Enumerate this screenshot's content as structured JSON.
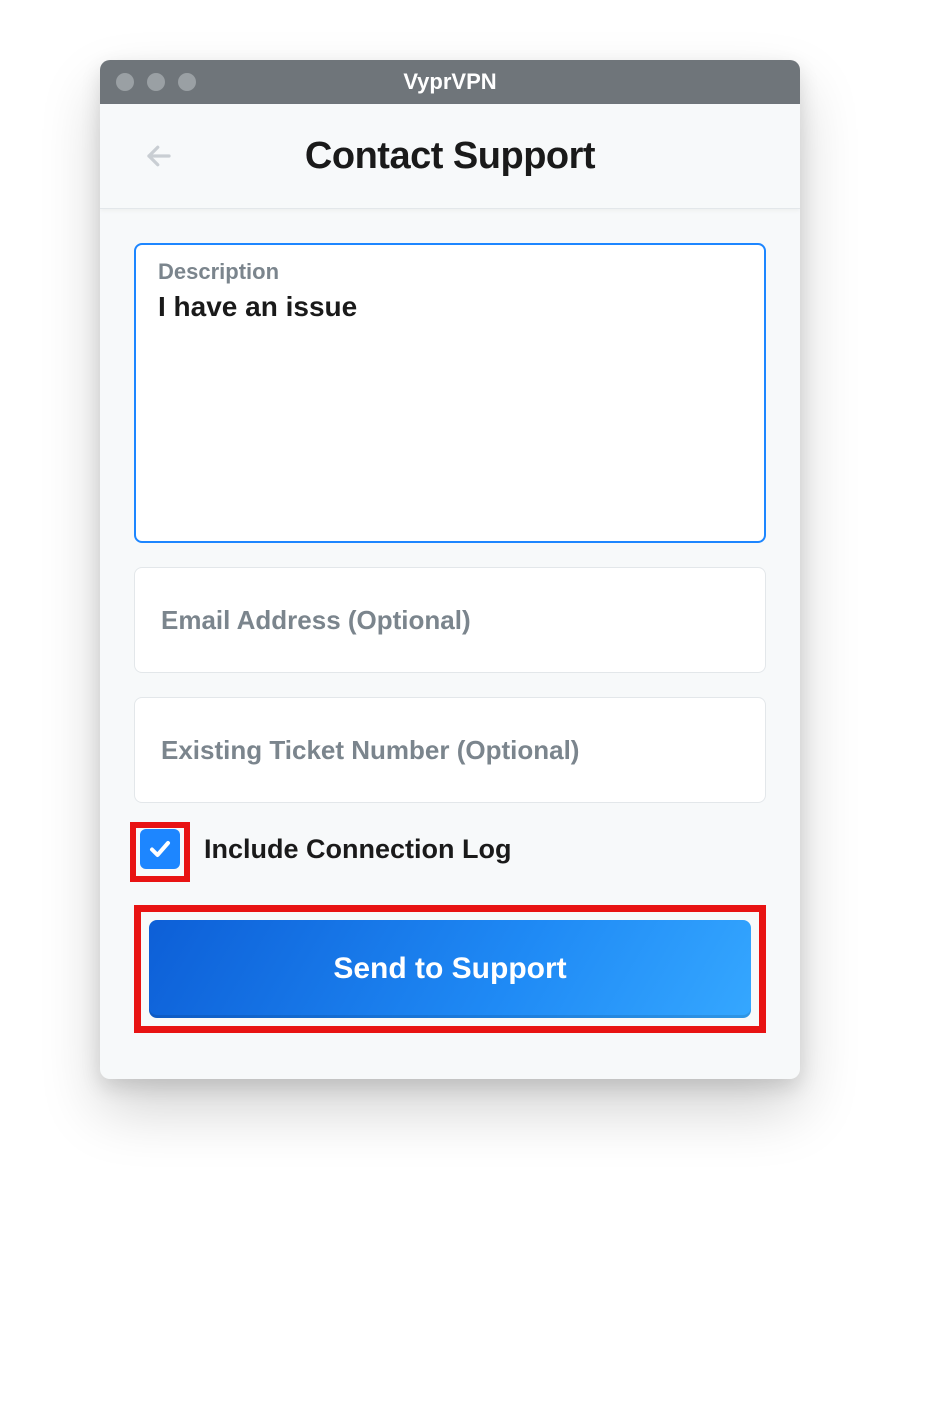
{
  "window": {
    "title": "VyprVPN"
  },
  "header": {
    "title": "Contact Support"
  },
  "form": {
    "description": {
      "label": "Description",
      "value": "I have an issue"
    },
    "email": {
      "placeholder": "Email Address (Optional)",
      "value": ""
    },
    "ticket": {
      "placeholder": "Existing Ticket Number (Optional)",
      "value": ""
    },
    "include_log": {
      "label": "Include Connection Log",
      "checked": true
    },
    "submit": {
      "label": "Send to Support"
    }
  },
  "colors": {
    "accent": "#1d86ff",
    "highlight": "#e81313"
  }
}
